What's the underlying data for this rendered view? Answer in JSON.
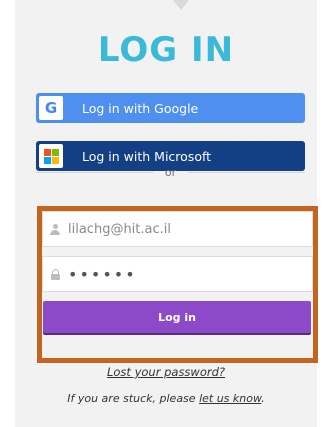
{
  "title": "LOG IN",
  "sso": {
    "google_label": "Log in with Google",
    "microsoft_label": "Log in with Microsoft"
  },
  "divider_text": "or",
  "form": {
    "email_value": "lilachg@hit.ac.il",
    "password_value": "••••••",
    "login_button": "Log in"
  },
  "links": {
    "lost_password": "Lost your password?",
    "stuck_prefix": "If you are stuck, please ",
    "stuck_link": "let us know",
    "stuck_suffix": "."
  },
  "colors": {
    "title": "#3bb9d8",
    "google_button": "#4e8ff0",
    "microsoft_button": "#133f85",
    "login_button": "#8c4ac8",
    "highlight_frame": "#c4651f"
  },
  "icons": {
    "google": "google-g-icon",
    "microsoft": "microsoft-logo-icon",
    "user": "user-icon",
    "lock": "lock-icon"
  }
}
